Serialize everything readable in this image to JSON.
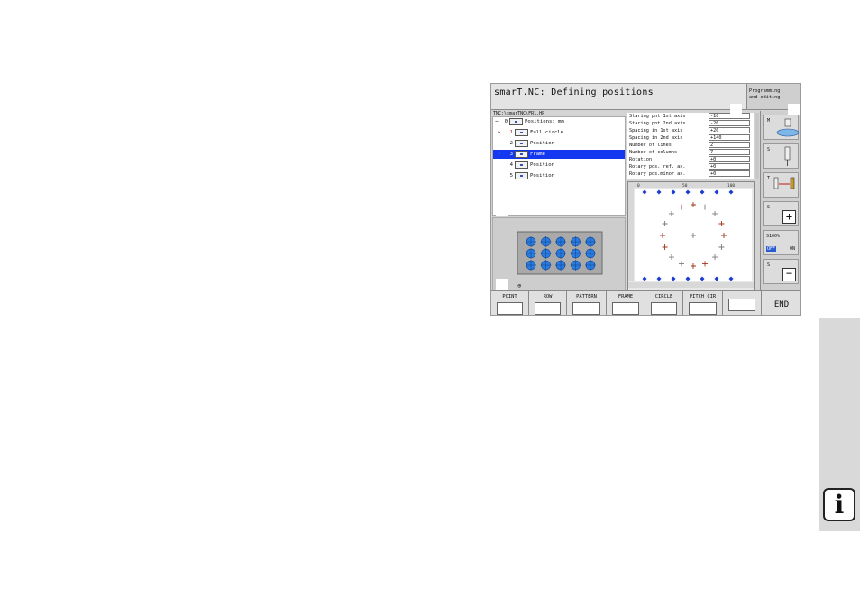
{
  "screen": {
    "title": "smarT.NC: Defining positions",
    "mode_line1": "Programming",
    "mode_line2": "and editing",
    "path": "TNC:\\smarTNC\\FR1.HP"
  },
  "tree": [
    {
      "num": "0",
      "label": "Positions: mm"
    },
    {
      "num": "1",
      "label": "Full circle"
    },
    {
      "num": "2",
      "label": "Position"
    },
    {
      "num": "3",
      "label": "Frame",
      "selected": true
    },
    {
      "num": "4",
      "label": "Position"
    },
    {
      "num": "5",
      "label": "Position"
    }
  ],
  "params": [
    {
      "label": "Staring pnt 1st axis",
      "value": "-10"
    },
    {
      "label": "Staring pnt 2nd axis",
      "value": "-20"
    },
    {
      "label": "Spacing in 1st axis",
      "value": "+20"
    },
    {
      "label": "Spacing in 2nd axis",
      "value": "+140"
    },
    {
      "label": "Number of lines",
      "value": "2"
    },
    {
      "label": "Number of columns",
      "value": "7"
    },
    {
      "label": "Rotation",
      "value": "+0"
    },
    {
      "label": "Rotary pos. ref. ax.",
      "value": "+0"
    },
    {
      "label": "Rotary pos.minor ax.",
      "value": "+0"
    }
  ],
  "graphic": {
    "ruler_marks": [
      "0",
      "50",
      "100"
    ]
  },
  "sidebar": {
    "m": "M",
    "s": "S",
    "t": "T",
    "s2": "S",
    "s_override": "S100%",
    "off": "OFF",
    "on": "ON",
    "s3": "S"
  },
  "softkeys": [
    "POINT",
    "ROW",
    "PATTERN",
    "FRAME",
    "CIRCLE",
    "PITCH CIR",
    "",
    "END"
  ],
  "colors": {
    "selection": "#1438f0",
    "dot_blue": "#1a3bd0",
    "dot_red": "#a03418",
    "hole_blue": "#2a7be0"
  }
}
